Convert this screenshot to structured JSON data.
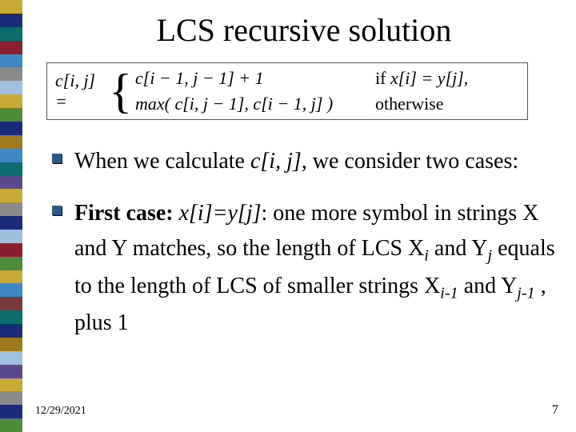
{
  "title": "LCS recursive solution",
  "formula": {
    "lhs": "c[i, j] =",
    "case1_expr": "c[i − 1, j − 1] + 1",
    "case1_cond_prefix": "if ",
    "case1_cond": "x[i] = y[j],",
    "case2_expr": "max( c[i, j − 1], c[i − 1, j] )",
    "case2_cond": "otherwise"
  },
  "bullets": {
    "b1_a": "When we calculate ",
    "b1_cij": "c[i, j],",
    "b1_b": " we consider two cases: ",
    "b2_first": "First case:",
    "b2_eq": " x[i]=y[j]",
    "b2_a": ": one more symbol in strings X and Y matches, so the length of LCS X",
    "b2_sub_i": "i",
    "b2_b": " and Y",
    "b2_sub_j": "j",
    "b2_c": " equals to the length of LCS of smaller strings X",
    "b2_sub_i1": "i-1",
    "b2_d": " and Y",
    "b2_sub_j1": "j-1",
    "b2_e": " , plus 1"
  },
  "footer": {
    "date": "12/29/2021",
    "page": "7"
  },
  "chart_data": {
    "type": "table",
    "title": "LCS recurrence definition",
    "rows": [
      {
        "case": "x[i] = y[j]",
        "value": "c[i-1, j-1] + 1"
      },
      {
        "case": "otherwise",
        "value": "max(c[i, j-1], c[i-1, j])"
      }
    ]
  }
}
